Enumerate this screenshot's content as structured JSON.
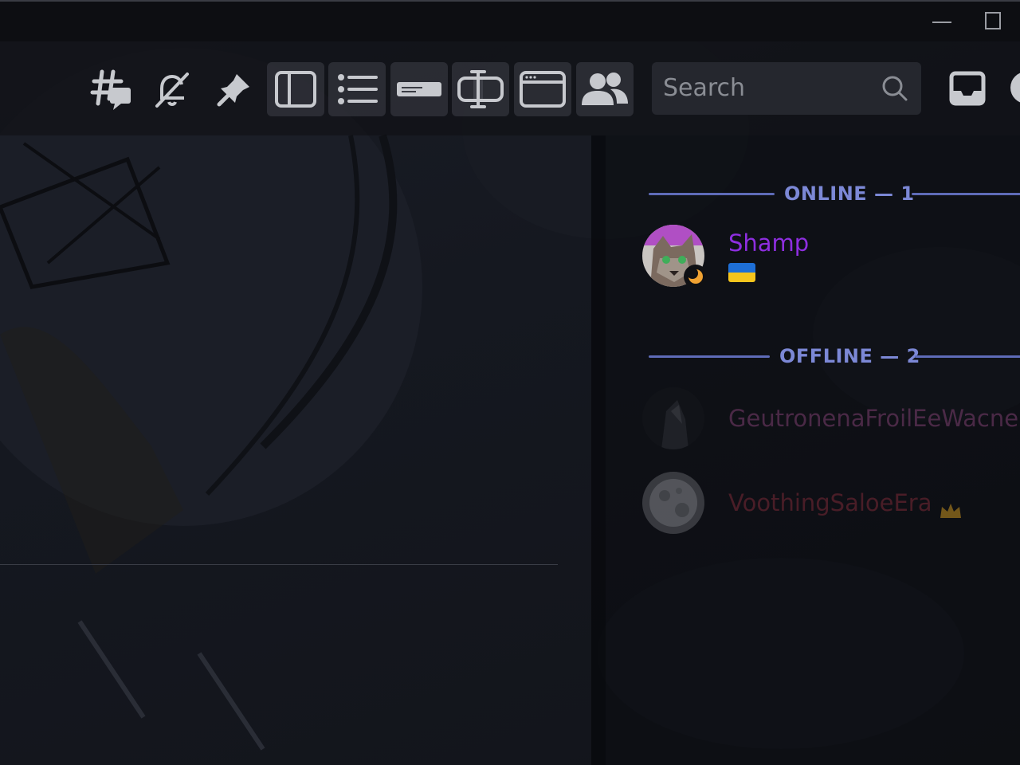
{
  "window": {
    "minimize_label": "Minimize",
    "maximize_label": "Maximize"
  },
  "toolbar": {
    "buttons": [
      {
        "name": "threads",
        "icon": "threads-icon"
      },
      {
        "name": "notifications-muted",
        "icon": "bell-muted-icon"
      },
      {
        "name": "pinned-messages",
        "icon": "pin-icon"
      },
      {
        "name": "toggle-sidebar",
        "icon": "sidebar-panel-icon"
      },
      {
        "name": "channel-list",
        "icon": "list-icon"
      },
      {
        "name": "compact-mode",
        "icon": "bar-icon"
      },
      {
        "name": "text-cursor",
        "icon": "text-cursor-icon"
      },
      {
        "name": "window-view",
        "icon": "window-icon"
      },
      {
        "name": "member-list",
        "icon": "members-icon"
      }
    ],
    "search": {
      "placeholder": "Search"
    },
    "inbox_icon": "inbox-icon",
    "help_icon": "help-icon"
  },
  "members": {
    "online_header": "ONLINE — 1",
    "offline_header": "OFFLINE — 2",
    "online": [
      {
        "name": "Shamp",
        "color": "#8e2ee0",
        "status": "idle",
        "badge": "ukraine-flag"
      }
    ],
    "offline": [
      {
        "name": "GeutronenaFroilEeWacne",
        "color": "#5c2f52"
      },
      {
        "name": "VoothingSaloeEra",
        "color": "#5a1e26",
        "badge": "crown-icon"
      }
    ]
  },
  "colors": {
    "accent": "#7c88d6",
    "idle": "#f0a232",
    "crown": "#c8921f"
  }
}
